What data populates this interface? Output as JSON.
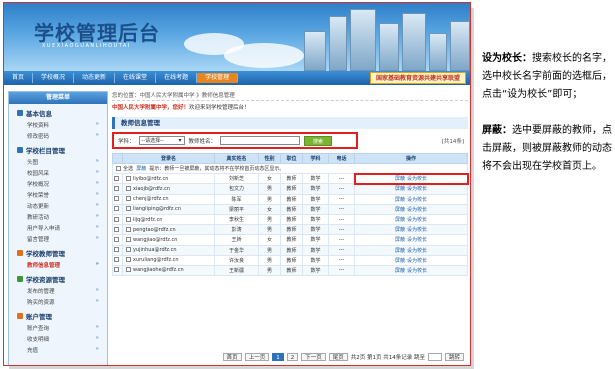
{
  "banner": {
    "title": "学校管理后台",
    "subtitle": "XUEXIAOGUANLIHOUTAI"
  },
  "nav": {
    "items": [
      "首页",
      "学校概况",
      "动态更新",
      "在线课堂",
      "在线考题",
      "学校管理"
    ],
    "active": 5,
    "slogan": "国家基础教育资源共建共享联盟"
  },
  "side": {
    "head": "管理菜单",
    "groups": [
      {
        "title": "基本信息",
        "color": "#2f72b9",
        "subs": [
          "学校资料",
          "修改密码"
        ]
      },
      {
        "title": "学校栏目管理",
        "color": "#2f72b9",
        "subs": [
          "头图",
          "校园风采",
          "学校概况",
          "学校荣誉",
          "动态更新",
          "教研活动",
          "用户导入申请",
          "留言管理"
        ]
      },
      {
        "title": "学校教师管理",
        "color": "#e0701e",
        "subs": [
          "教师信息管理"
        ],
        "active_sub": 0
      },
      {
        "title": "学校资源管理",
        "color": "#3a9a3a",
        "subs": [
          "发布的管理",
          "购买的资源"
        ]
      },
      {
        "title": "账户管理",
        "color": "#e0701e",
        "subs": [
          "账户查询",
          "收支明细",
          "充值"
        ]
      }
    ]
  },
  "main": {
    "crumb": "您的位置：中国人民大学附属中学 》教师信息管理",
    "welcome_name": "中国人民大学附属中学，您好！",
    "welcome_rest": "欢迎来到学校管理后台！",
    "page_title": "教师信息管理",
    "search": {
      "subject_label": "学科：",
      "subject_value": "--请选择--",
      "name_label": "教师姓名：",
      "button": "搜索",
      "count": "[共14条]"
    },
    "table": {
      "headers": [
        "",
        "登录名",
        "真实姓名",
        "性别",
        "职位",
        "学科",
        "电话",
        "操作"
      ],
      "select_all": "全选",
      "bulk_action": "屏蔽",
      "notice": "提示：教师一旦被屏蔽，其动态将不在学校首页动态区显示。",
      "rows": [
        {
          "login": "liyibo@rdfz.cn",
          "name": "刘新芝",
          "sex": "女",
          "pos": "教师",
          "subject": "数学",
          "phone": "---"
        },
        {
          "login": "xiaojb@rdfz.cn",
          "name": "包文力",
          "sex": "男",
          "pos": "教师",
          "subject": "数学",
          "phone": "---"
        },
        {
          "login": "chenj@rdfz.cn",
          "name": "陈军",
          "sex": "男",
          "pos": "教师",
          "subject": "数学",
          "phone": "---"
        },
        {
          "login": "liangliping@rdfz.cn",
          "name": "梁丽平",
          "sex": "女",
          "pos": "教师",
          "subject": "数学",
          "phone": "---"
        },
        {
          "login": "lijq@rdfz.cn",
          "name": "李秋生",
          "sex": "男",
          "pos": "教师",
          "subject": "数学",
          "phone": "---"
        },
        {
          "login": "pengtao@rdfz.cn",
          "name": "彭涛",
          "sex": "男",
          "pos": "教师",
          "subject": "数学",
          "phone": "---"
        },
        {
          "login": "wangjiao@rdfz.cn",
          "name": "王娇",
          "sex": "女",
          "pos": "教师",
          "subject": "数学",
          "phone": "---"
        },
        {
          "login": "yujinhua@rdfz.cn",
          "name": "于金华",
          "sex": "男",
          "pos": "教师",
          "subject": "数学",
          "phone": "---"
        },
        {
          "login": "xuruliang@rdfz.cn",
          "name": "许汝良",
          "sex": "男",
          "pos": "教师",
          "subject": "数学",
          "phone": "---"
        },
        {
          "login": "wangjiaohe@rdfz.cn",
          "name": "王新疆",
          "sex": "男",
          "pos": "教师",
          "subject": "数学",
          "phone": "---"
        }
      ],
      "op_block": "屏蔽",
      "op_principal": "设为校长"
    },
    "pager": {
      "home": "首页",
      "prev": "上一页",
      "page1": "1",
      "page2": "2",
      "next": "下一页",
      "last": "尾页",
      "info": "共2页 第1页 共14条记录 跳至",
      "go": "跳转"
    }
  },
  "right": {
    "p1_bold": "设为校长：",
    "p1_text": "搜索校长的名字，选中校长名字前面的选框后，点击“设为校长”即可；",
    "p2_bold": "屏蔽：",
    "p2_text": "选中要屏蔽的教师，点击屏蔽，则被屏蔽教师的动态将不会出现在学校首页上。"
  }
}
